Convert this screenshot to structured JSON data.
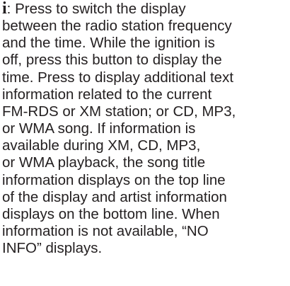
{
  "manual": {
    "info_symbol": "i",
    "lines": [
      ":  Press to switch the display",
      "between the radio station frequency",
      "and the time. While the ignition is",
      "off, press this button to display the",
      "time. Press to display additional text",
      "information related to the current",
      "FM-RDS or XM station; or CD, MP3,",
      "or WMA song. If information is",
      "available during XM, CD, MP3,",
      "or WMA playback, the song title",
      "information displays on the top line",
      "of the display and artist information",
      "displays on the bottom line. When",
      "information is not available, “NO",
      "INFO” displays."
    ]
  }
}
